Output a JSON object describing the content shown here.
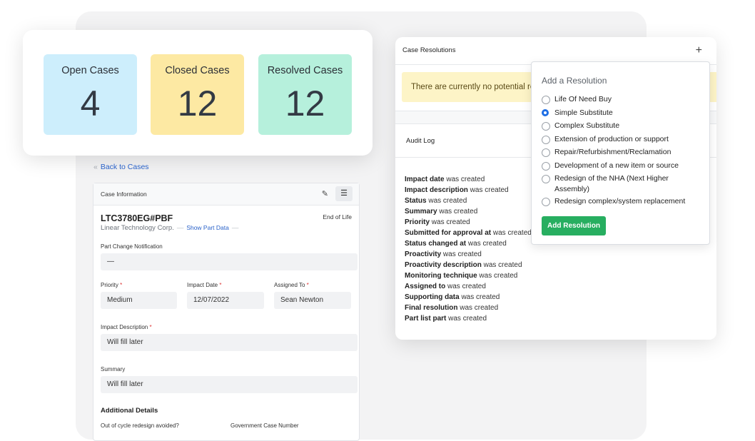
{
  "stats": {
    "open": {
      "label": "Open Cases",
      "value": "4"
    },
    "closed": {
      "label": "Closed Cases",
      "value": "12"
    },
    "resolved": {
      "label": "Resolved Cases",
      "value": "12"
    }
  },
  "nav": {
    "back_chevron": "«",
    "back_label": "Back to Cases"
  },
  "case_info": {
    "header": "Case Information",
    "part_number": "LTC3780EG#PBF",
    "lifecycle": "End of Life",
    "manufacturer": "Linear Technology Corp.",
    "dash": "—",
    "show_part_data": "Show Part Data",
    "pcn_label": "Part Change Notification",
    "pcn_value": "—",
    "priority_label": "Priority",
    "priority_value": "Medium",
    "impact_date_label": "Impact Date",
    "impact_date_value": "12/07/2022",
    "assigned_label": "Assigned To",
    "assigned_value": "Sean Newton",
    "required_mark": "*",
    "impact_desc_label": "Impact Description",
    "impact_desc_value": "Will fill later",
    "summary_label": "Summary",
    "summary_value": "Will fill later",
    "additional_details": "Additional Details",
    "field_a_label": "Out of cycle redesign avoided?",
    "field_b_label": "Government Case Number"
  },
  "resolutions": {
    "header": "Case Resolutions",
    "warning": "There are currently no potential resolutions",
    "audit_header": "Audit Log",
    "audit_entries": [
      {
        "field": "Impact date",
        "rest": " was created"
      },
      {
        "field": "Impact description",
        "rest": " was created"
      },
      {
        "field": "Status",
        "rest": " was created"
      },
      {
        "field": "Summary",
        "rest": " was created"
      },
      {
        "field": "Priority",
        "rest": " was created"
      },
      {
        "field": "Submitted for approval at",
        "rest": " was created"
      },
      {
        "field": "Status changed at",
        "rest": " was created"
      },
      {
        "field": "Proactivity",
        "rest": " was created"
      },
      {
        "field": "Proactivity description",
        "rest": " was created"
      },
      {
        "field": "Monitoring technique",
        "rest": " was created"
      },
      {
        "field": "Assigned to",
        "rest": " was created"
      },
      {
        "field": "Supporting data",
        "rest": " was created"
      },
      {
        "field": "Final resolution",
        "rest": " was created"
      },
      {
        "field": "Part list part",
        "rest": " was created"
      }
    ]
  },
  "add_resolution": {
    "title": "Add a Resolution",
    "selected_index": 1,
    "options": [
      "Life Of Need Buy",
      "Simple Substitute",
      "Complex Substitute",
      "Extension of production or support",
      "Repair/Refurbishment/Reclamation",
      "Development of a new item or source",
      "Redesign of the NHA (Next Higher Assembly)",
      "Redesign complex/system replacement"
    ],
    "button": "Add Resolution"
  },
  "colors": {
    "accent": "#2a62c9",
    "success": "#27ae60",
    "radio_selected": "#1f6fe5"
  }
}
